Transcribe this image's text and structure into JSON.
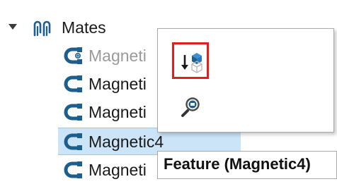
{
  "tree": {
    "root": {
      "label": "Mates",
      "icon": "mates-folder-icon",
      "expanded": true
    },
    "items": [
      {
        "label": "Magneti",
        "state": "suppressed",
        "icon": "magnetic-mate-icon"
      },
      {
        "label": "Magneti",
        "state": "normal",
        "icon": "magnetic-mate-icon"
      },
      {
        "label": "Magneti",
        "state": "normal",
        "icon": "magnetic-mate-icon"
      },
      {
        "label": "Magnetic4",
        "state": "selected",
        "icon": "magnetic-mate-icon"
      },
      {
        "label": "Magneti",
        "state": "normal",
        "icon": "magnetic-mate-icon"
      }
    ]
  },
  "context_toolbar": {
    "buttons": [
      {
        "icon": "move-to-folder-icon",
        "highlighted": true
      },
      {
        "icon": "zoom-to-selection-icon",
        "highlighted": false
      }
    ]
  },
  "tooltip": {
    "text": "Feature (Magnetic4)"
  },
  "colors": {
    "selection_fill": "#cce4f7",
    "selection_border": "#99c9ef",
    "highlight_border": "#e01e1e",
    "mate_icon_blue": "#1c5f8f",
    "suppressed_text": "#9a9a9a"
  }
}
